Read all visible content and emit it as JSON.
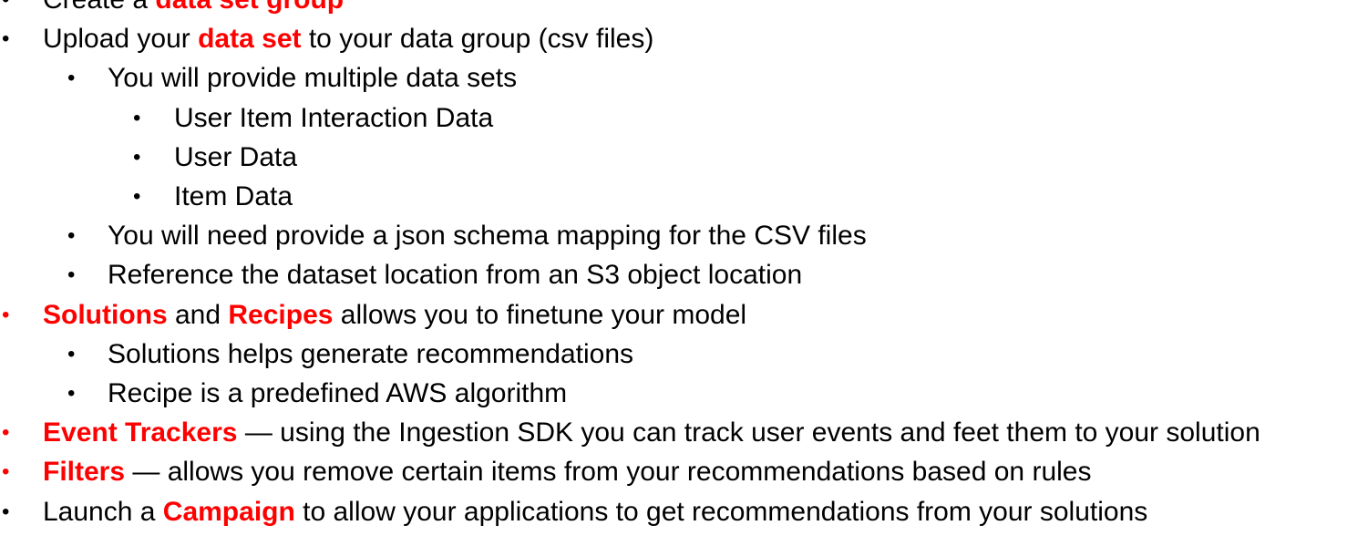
{
  "colors": {
    "highlight": "#ff0000",
    "text": "#000000",
    "background": "#ffffff"
  },
  "bullet_char": "•",
  "lines": [
    {
      "level": 1,
      "bullet_color": "#000000",
      "segments": [
        {
          "text": "Create a ",
          "hl": false
        },
        {
          "text": "data set group",
          "hl": true
        }
      ]
    },
    {
      "level": 1,
      "bullet_color": "#000000",
      "segments": [
        {
          "text": "Upload your ",
          "hl": false
        },
        {
          "text": "data set",
          "hl": true
        },
        {
          "text": " to your data group (csv files)",
          "hl": false
        }
      ]
    },
    {
      "level": 2,
      "bullet_color": "#000000",
      "segments": [
        {
          "text": "You will provide multiple data sets",
          "hl": false
        }
      ]
    },
    {
      "level": 3,
      "bullet_color": "#000000",
      "segments": [
        {
          "text": "User Item Interaction Data",
          "hl": false
        }
      ]
    },
    {
      "level": 3,
      "bullet_color": "#000000",
      "segments": [
        {
          "text": "User Data",
          "hl": false
        }
      ]
    },
    {
      "level": 3,
      "bullet_color": "#000000",
      "segments": [
        {
          "text": "Item Data",
          "hl": false
        }
      ]
    },
    {
      "level": 2,
      "bullet_color": "#000000",
      "segments": [
        {
          "text": "You will need provide a json schema mapping for the CSV files",
          "hl": false
        }
      ]
    },
    {
      "level": 2,
      "bullet_color": "#000000",
      "segments": [
        {
          "text": "Reference the dataset location from an S3 object location",
          "hl": false
        }
      ]
    },
    {
      "level": 1,
      "bullet_color": "#ff0000",
      "segments": [
        {
          "text": "Solutions",
          "hl": true
        },
        {
          "text": " and ",
          "hl": false
        },
        {
          "text": "Recipes",
          "hl": true
        },
        {
          "text": " allows you to finetune your model",
          "hl": false
        }
      ]
    },
    {
      "level": 2,
      "bullet_color": "#000000",
      "segments": [
        {
          "text": "Solutions helps generate recommendations",
          "hl": false
        }
      ]
    },
    {
      "level": 2,
      "bullet_color": "#000000",
      "segments": [
        {
          "text": "Recipe is a predefined AWS algorithm",
          "hl": false
        }
      ]
    },
    {
      "level": 1,
      "bullet_color": "#ff0000",
      "segments": [
        {
          "text": "Event Trackers",
          "hl": true
        },
        {
          "text": " — using the Ingestion SDK you can track user events and feet them to your solution",
          "hl": false
        }
      ]
    },
    {
      "level": 1,
      "bullet_color": "#ff0000",
      "segments": [
        {
          "text": "Filters",
          "hl": true
        },
        {
          "text": " — allows you remove certain items from your recommendations based on rules",
          "hl": false
        }
      ]
    },
    {
      "level": 1,
      "bullet_color": "#000000",
      "segments": [
        {
          "text": "Launch a ",
          "hl": false
        },
        {
          "text": "Campaign",
          "hl": true
        },
        {
          "text": " to allow your applications to get recommendations from your solutions",
          "hl": false
        }
      ]
    }
  ]
}
